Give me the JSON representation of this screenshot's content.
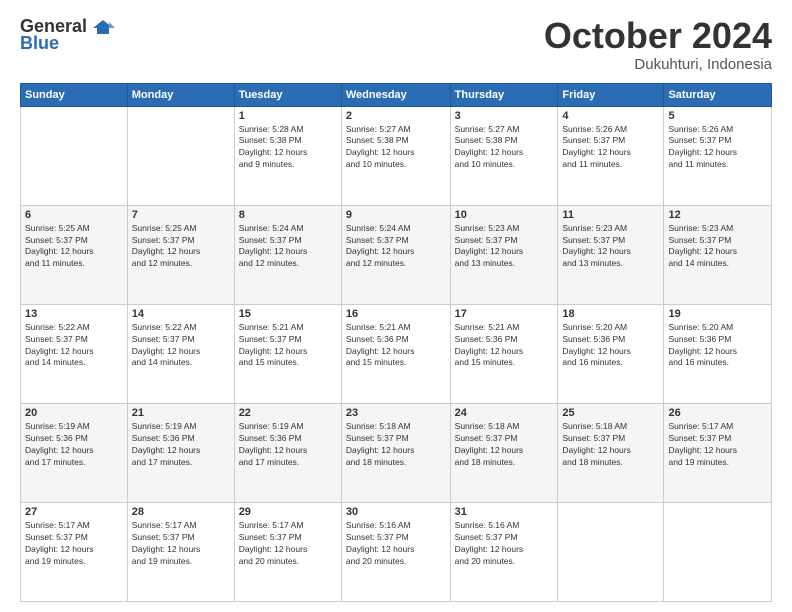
{
  "logo": {
    "general": "General",
    "blue": "Blue"
  },
  "title": "October 2024",
  "location": "Dukuhturi, Indonesia",
  "weekdays": [
    "Sunday",
    "Monday",
    "Tuesday",
    "Wednesday",
    "Thursday",
    "Friday",
    "Saturday"
  ],
  "weeks": [
    [
      {
        "day": "",
        "info": ""
      },
      {
        "day": "",
        "info": ""
      },
      {
        "day": "1",
        "info": "Sunrise: 5:28 AM\nSunset: 5:38 PM\nDaylight: 12 hours\nand 9 minutes."
      },
      {
        "day": "2",
        "info": "Sunrise: 5:27 AM\nSunset: 5:38 PM\nDaylight: 12 hours\nand 10 minutes."
      },
      {
        "day": "3",
        "info": "Sunrise: 5:27 AM\nSunset: 5:38 PM\nDaylight: 12 hours\nand 10 minutes."
      },
      {
        "day": "4",
        "info": "Sunrise: 5:26 AM\nSunset: 5:37 PM\nDaylight: 12 hours\nand 11 minutes."
      },
      {
        "day": "5",
        "info": "Sunrise: 5:26 AM\nSunset: 5:37 PM\nDaylight: 12 hours\nand 11 minutes."
      }
    ],
    [
      {
        "day": "6",
        "info": "Sunrise: 5:25 AM\nSunset: 5:37 PM\nDaylight: 12 hours\nand 11 minutes."
      },
      {
        "day": "7",
        "info": "Sunrise: 5:25 AM\nSunset: 5:37 PM\nDaylight: 12 hours\nand 12 minutes."
      },
      {
        "day": "8",
        "info": "Sunrise: 5:24 AM\nSunset: 5:37 PM\nDaylight: 12 hours\nand 12 minutes."
      },
      {
        "day": "9",
        "info": "Sunrise: 5:24 AM\nSunset: 5:37 PM\nDaylight: 12 hours\nand 12 minutes."
      },
      {
        "day": "10",
        "info": "Sunrise: 5:23 AM\nSunset: 5:37 PM\nDaylight: 12 hours\nand 13 minutes."
      },
      {
        "day": "11",
        "info": "Sunrise: 5:23 AM\nSunset: 5:37 PM\nDaylight: 12 hours\nand 13 minutes."
      },
      {
        "day": "12",
        "info": "Sunrise: 5:23 AM\nSunset: 5:37 PM\nDaylight: 12 hours\nand 14 minutes."
      }
    ],
    [
      {
        "day": "13",
        "info": "Sunrise: 5:22 AM\nSunset: 5:37 PM\nDaylight: 12 hours\nand 14 minutes."
      },
      {
        "day": "14",
        "info": "Sunrise: 5:22 AM\nSunset: 5:37 PM\nDaylight: 12 hours\nand 14 minutes."
      },
      {
        "day": "15",
        "info": "Sunrise: 5:21 AM\nSunset: 5:37 PM\nDaylight: 12 hours\nand 15 minutes."
      },
      {
        "day": "16",
        "info": "Sunrise: 5:21 AM\nSunset: 5:36 PM\nDaylight: 12 hours\nand 15 minutes."
      },
      {
        "day": "17",
        "info": "Sunrise: 5:21 AM\nSunset: 5:36 PM\nDaylight: 12 hours\nand 15 minutes."
      },
      {
        "day": "18",
        "info": "Sunrise: 5:20 AM\nSunset: 5:36 PM\nDaylight: 12 hours\nand 16 minutes."
      },
      {
        "day": "19",
        "info": "Sunrise: 5:20 AM\nSunset: 5:36 PM\nDaylight: 12 hours\nand 16 minutes."
      }
    ],
    [
      {
        "day": "20",
        "info": "Sunrise: 5:19 AM\nSunset: 5:36 PM\nDaylight: 12 hours\nand 17 minutes."
      },
      {
        "day": "21",
        "info": "Sunrise: 5:19 AM\nSunset: 5:36 PM\nDaylight: 12 hours\nand 17 minutes."
      },
      {
        "day": "22",
        "info": "Sunrise: 5:19 AM\nSunset: 5:36 PM\nDaylight: 12 hours\nand 17 minutes."
      },
      {
        "day": "23",
        "info": "Sunrise: 5:18 AM\nSunset: 5:37 PM\nDaylight: 12 hours\nand 18 minutes."
      },
      {
        "day": "24",
        "info": "Sunrise: 5:18 AM\nSunset: 5:37 PM\nDaylight: 12 hours\nand 18 minutes."
      },
      {
        "day": "25",
        "info": "Sunrise: 5:18 AM\nSunset: 5:37 PM\nDaylight: 12 hours\nand 18 minutes."
      },
      {
        "day": "26",
        "info": "Sunrise: 5:17 AM\nSunset: 5:37 PM\nDaylight: 12 hours\nand 19 minutes."
      }
    ],
    [
      {
        "day": "27",
        "info": "Sunrise: 5:17 AM\nSunset: 5:37 PM\nDaylight: 12 hours\nand 19 minutes."
      },
      {
        "day": "28",
        "info": "Sunrise: 5:17 AM\nSunset: 5:37 PM\nDaylight: 12 hours\nand 19 minutes."
      },
      {
        "day": "29",
        "info": "Sunrise: 5:17 AM\nSunset: 5:37 PM\nDaylight: 12 hours\nand 20 minutes."
      },
      {
        "day": "30",
        "info": "Sunrise: 5:16 AM\nSunset: 5:37 PM\nDaylight: 12 hours\nand 20 minutes."
      },
      {
        "day": "31",
        "info": "Sunrise: 5:16 AM\nSunset: 5:37 PM\nDaylight: 12 hours\nand 20 minutes."
      },
      {
        "day": "",
        "info": ""
      },
      {
        "day": "",
        "info": ""
      }
    ]
  ]
}
